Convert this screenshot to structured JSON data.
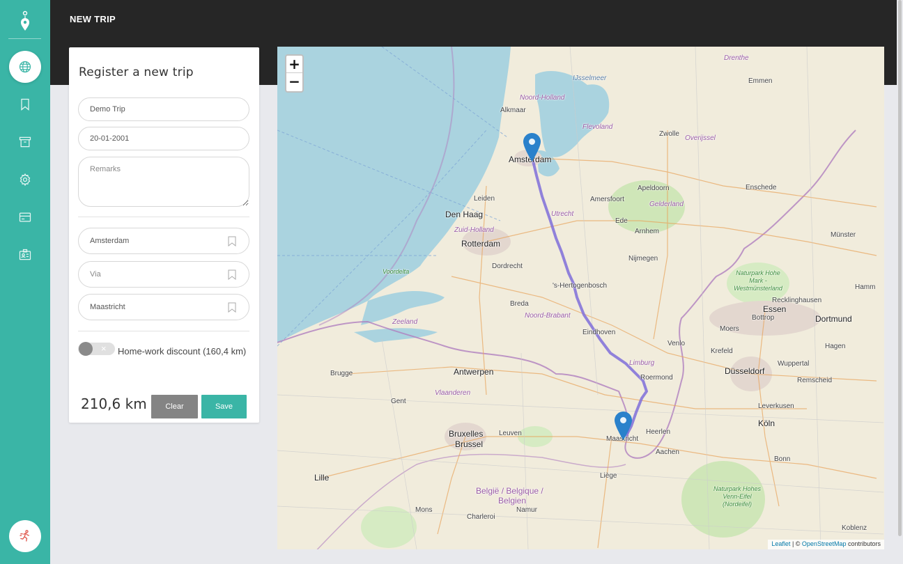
{
  "header": {
    "title": "NEW TRIP"
  },
  "sidebar": {
    "items": [
      {
        "icon": "globe-icon",
        "active": true
      },
      {
        "icon": "bookmark-icon",
        "active": false
      },
      {
        "icon": "archive-icon",
        "active": false
      },
      {
        "icon": "gear-icon",
        "active": false
      },
      {
        "icon": "credit-card-icon",
        "active": false
      },
      {
        "icon": "id-card-icon",
        "active": false
      }
    ],
    "bottom_icon": "runner-icon"
  },
  "form": {
    "title": "Register a new trip",
    "trip_name": "Demo Trip",
    "date": "20-01-2001",
    "remarks_placeholder": "Remarks",
    "origin": "Amsterdam",
    "via_placeholder": "Via",
    "destination": "Maastricht",
    "discount_label": "Home-work discount (160,4 km)",
    "discount_enabled": false,
    "distance": "210,6 km",
    "clear_label": "Clear",
    "save_label": "Save"
  },
  "map": {
    "zoom_in": "+",
    "zoom_out": "−",
    "attribution_leaflet": "Leaflet",
    "attribution_sep": " | © ",
    "attribution_osm": "OpenStreetMap",
    "attribution_tail": " contributors",
    "labels": {
      "amsterdam": "Amsterdam",
      "alkmaar": "Alkmaar",
      "leiden": "Leiden",
      "denhaag": "Den Haag",
      "rotterdam": "Rotterdam",
      "dordrecht": "Dordrecht",
      "breda": "Breda",
      "utrecht": "Utrecht",
      "amersfoort": "Amersfoort",
      "apeldoorn": "Apeldoorn",
      "zwolle": "Zwolle",
      "emmen": "Emmen",
      "enschede": "Enschede",
      "arnhem": "Arnhem",
      "nijmegen": "Nijmegen",
      "ede": "Ede",
      "hertogenbosch": "'s-Hertogenbosch",
      "eindhoven": "Eindhoven",
      "venlo": "Venlo",
      "roermond": "Roermond",
      "maastricht": "Maastricht",
      "heerlen": "Heerlen",
      "aachen": "Aachen",
      "antwerpen": "Antwerpen",
      "brugge": "Brugge",
      "gent": "Gent",
      "leuven": "Leuven",
      "bruxelles": "Bruxelles",
      "brussel": "Brussel",
      "lille": "Lille",
      "liege": "Liège",
      "charleroi": "Charleroi",
      "mons": "Mons",
      "namur": "Namur",
      "dusseldorf": "Düsseldorf",
      "essen": "Essen",
      "dortmund": "Dortmund",
      "koln": "Köln",
      "bonn": "Bonn",
      "munster": "Münster",
      "krefeld": "Krefeld",
      "wuppertal": "Wuppertal",
      "bottrop": "Bottrop",
      "moers": "Moers",
      "hamm": "Hamm",
      "leverkusen": "Leverkusen",
      "remscheid": "Remscheid",
      "recklinghausen": "Recklinghausen",
      "hagen": "Hagen",
      "koblenz": "Koblenz",
      "noordholland": "Noord-Holland",
      "zuidholland": "Zuid-Holland",
      "flevoland": "Flevoland",
      "overijssel": "Overijssel",
      "gelderland": "Gelderland",
      "drenthe": "Drenthe",
      "noordbrabant": "Noord-Brabant",
      "limburg": "Limburg",
      "zeeland": "Zeeland",
      "vlaanderen": "Vlaanderen",
      "ijsselmeer": "IJsselmeer",
      "voordelta": "Voordelta",
      "belgie": "België / Belgique /",
      "belgien": "Belgien",
      "hohemark": "Naturpark Hohe Mark - Westmünsterland",
      "hoheseifel": "Naturpark Hohes Venn-Eifel (Nordeifel)"
    }
  }
}
